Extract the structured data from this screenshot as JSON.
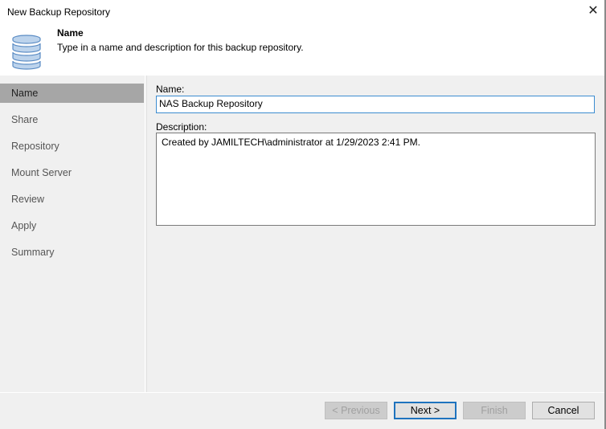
{
  "window": {
    "title": "New Backup Repository",
    "close_glyph": "✕"
  },
  "header": {
    "icon": "database-icon",
    "title": "Name",
    "description": "Type in a name and description for this backup repository."
  },
  "sidebar": {
    "steps": [
      {
        "label": "Name",
        "active": true
      },
      {
        "label": "Share",
        "active": false
      },
      {
        "label": "Repository",
        "active": false
      },
      {
        "label": "Mount Server",
        "active": false
      },
      {
        "label": "Review",
        "active": false
      },
      {
        "label": "Apply",
        "active": false
      },
      {
        "label": "Summary",
        "active": false
      }
    ]
  },
  "form": {
    "name_label": "Name:",
    "name_value": "NAS Backup Repository",
    "description_label": "Description:",
    "description_value": "Created by JAMILTECH\\administrator at 1/29/2023 2:41 PM."
  },
  "buttons": {
    "previous": "< Previous",
    "next": "Next >",
    "finish": "Finish",
    "cancel": "Cancel"
  },
  "colors": {
    "accent": "#1e73be",
    "active_step": "#a6a6a6",
    "icon_fill": "#bcd3ec",
    "icon_stroke": "#5b8cc4"
  }
}
